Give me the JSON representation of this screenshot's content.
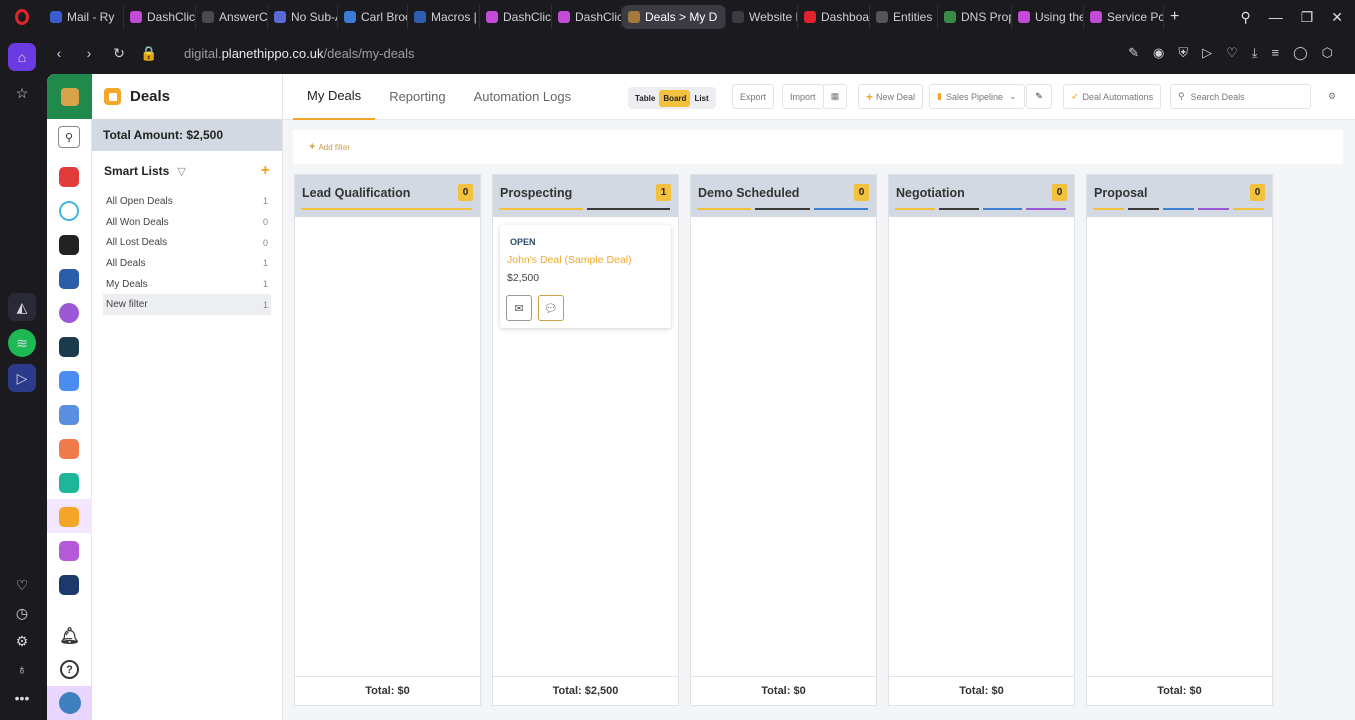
{
  "browser": {
    "tabs": [
      {
        "label": "Mail - Ry",
        "color": "#3b5ccc"
      },
      {
        "label": "DashClick",
        "color": "#c44bd8"
      },
      {
        "label": "AnswerCo",
        "color": "#4a4a4a"
      },
      {
        "label": "No Sub-A",
        "color": "#5a6ad8"
      },
      {
        "label": "Carl Broo",
        "color": "#3a7bd5"
      },
      {
        "label": "Macros |",
        "color": "#2e5fb5"
      },
      {
        "label": "DashClick",
        "color": "#c44bd8"
      },
      {
        "label": "DashClick",
        "color": "#c44bd8"
      },
      {
        "label": "Deals > My D",
        "color": "#a37a3b",
        "active": true
      },
      {
        "label": "Website E",
        "color": "#3b3b44"
      },
      {
        "label": "Dashboar",
        "color": "#e0232d"
      },
      {
        "label": "Entities",
        "color": "#555"
      },
      {
        "label": "DNS Prop",
        "color": "#3a8a4a"
      },
      {
        "label": "Using the",
        "color": "#c44bd8"
      },
      {
        "label": "Service Pc",
        "color": "#c44bd8"
      }
    ],
    "url_prefix": "digital.",
    "url_domain": "planethippo.co.uk",
    "url_path": "/deals/my-deals"
  },
  "panel": {
    "title": "Deals",
    "total_amount": "Total Amount: $2,500",
    "smart_lists_title": "Smart Lists",
    "smart_lists": [
      {
        "label": "All Open Deals",
        "count": "1"
      },
      {
        "label": "All Won Deals",
        "count": "0"
      },
      {
        "label": "All Lost Deals",
        "count": "0"
      },
      {
        "label": "All Deals",
        "count": "1"
      },
      {
        "label": "My Deals",
        "count": "1"
      },
      {
        "label": "New filter",
        "count": "1"
      }
    ]
  },
  "main": {
    "tabs": [
      "My Deals",
      "Reporting",
      "Automation Logs"
    ],
    "views": [
      "Table",
      "Board",
      "List"
    ],
    "export_label": "Export",
    "import_label": "Import",
    "new_deal_label": "New Deal",
    "pipeline_label": "Sales Pipeline",
    "automations_label": "Deal Automations",
    "search_placeholder": "Search Deals",
    "add_filter_label": "Add filter"
  },
  "board": {
    "columns": [
      {
        "title": "Lead Qualification",
        "count": "0",
        "total": "Total: $0",
        "bars": [
          "#f4c13f"
        ]
      },
      {
        "title": "Prospecting",
        "count": "1",
        "total": "Total: $2,500",
        "bars": [
          "#f4c13f",
          "#3a3a3a"
        ]
      },
      {
        "title": "Demo Scheduled",
        "count": "0",
        "total": "Total: $0",
        "bars": [
          "#f4c13f",
          "#3a3a3a",
          "#3e7fd6"
        ]
      },
      {
        "title": "Negotiation",
        "count": "0",
        "total": "Total: $0",
        "bars": [
          "#f4c13f",
          "#3a3a3a",
          "#3e7fd6",
          "#9b59d6"
        ]
      },
      {
        "title": "Proposal",
        "count": "0",
        "total": "Total: $0",
        "bars": [
          "#f4c13f",
          "#3a3a3a",
          "#3e7fd6",
          "#9b59d6",
          "#f4c13f"
        ]
      }
    ],
    "card": {
      "status": "OPEN",
      "name": "John's Deal (Sample Deal)",
      "amount": "$2,500"
    }
  }
}
